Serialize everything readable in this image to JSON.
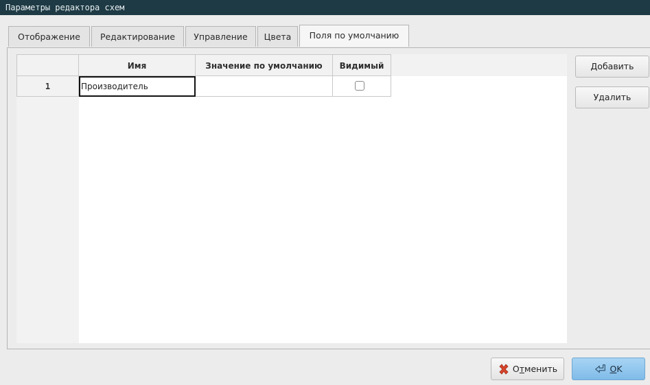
{
  "window": {
    "title": "Параметры редактора схем"
  },
  "tabs": [
    {
      "label": "Отображение"
    },
    {
      "label": "Редактирование"
    },
    {
      "label": "Управление"
    },
    {
      "label": "Цвета"
    },
    {
      "label": "Поля по умолчанию",
      "active": true
    }
  ],
  "table": {
    "columns": [
      "Имя",
      "Значение по умолчанию",
      "Видимый"
    ],
    "rows": [
      {
        "num": "1",
        "name": "Производитель",
        "default_value": "",
        "visible": false
      }
    ]
  },
  "side_buttons": {
    "add": "Добавить",
    "remove": "Удалить"
  },
  "dialog_buttons": {
    "cancel_first": "О",
    "cancel_underlined": "т",
    "cancel_rest": "менить",
    "ok_underlined": "O",
    "ok_rest": "K"
  },
  "icons": {
    "cancel": "red-x-icon",
    "ok": "enter-arrow-icon"
  },
  "colors": {
    "titlebar": "#1e3a44",
    "ok_button": "#8cc4ee",
    "cancel_icon": "#d9452b"
  }
}
